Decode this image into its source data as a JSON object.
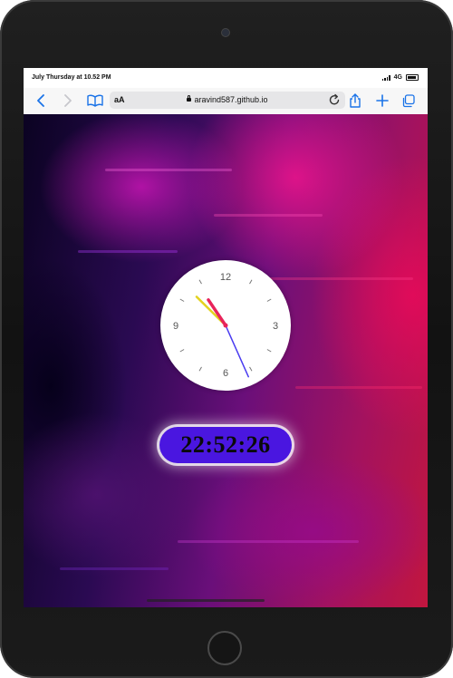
{
  "status_bar": {
    "datetime": "July Thursday at 10.52 PM",
    "network": "4G",
    "icons": [
      "signal-icon",
      "battery-icon"
    ]
  },
  "browser": {
    "text_size_label": "aA",
    "url": "aravind587.github.io",
    "icons": [
      "back-icon",
      "forward-icon",
      "bookmarks-icon",
      "lock-icon",
      "reload-icon",
      "share-icon",
      "new-tab-icon",
      "tabs-icon"
    ],
    "accent_color": "#1a73e8"
  },
  "clock": {
    "analog": {
      "numbers": {
        "twelve": "12",
        "three": "3",
        "six": "6",
        "nine": "9"
      },
      "time": {
        "hours": 22,
        "minutes": 52,
        "seconds": 26
      },
      "hand_colors": {
        "hour": "#e8245a",
        "minute": "#e3d21f",
        "second": "#4a3cf0"
      }
    },
    "digital": {
      "time": "22:52:26",
      "background_color": "#4a16e0"
    }
  }
}
